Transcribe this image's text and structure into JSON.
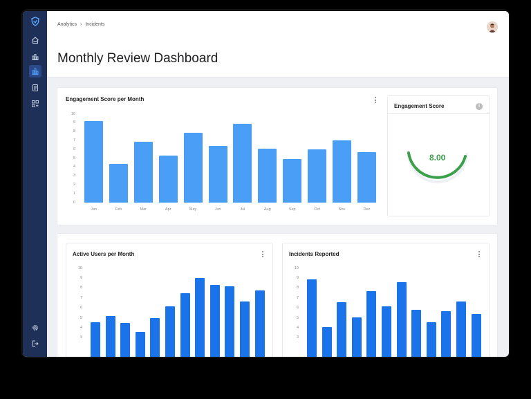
{
  "breadcrumb": {
    "items": [
      "Analytics",
      "Incidents"
    ],
    "separator": "›"
  },
  "page": {
    "title": "Monthly Review Dashboard"
  },
  "sidebar": {
    "icons": [
      "shield-logo-icon",
      "home-icon",
      "bar-chart-icon",
      "analytics-icon",
      "report-icon",
      "widgets-icon"
    ],
    "bottom_icons": [
      "settings-icon",
      "logout-icon"
    ],
    "active": "analytics-icon"
  },
  "engagement_chart": {
    "title": "Engagement Score per Month"
  },
  "gauge": {
    "title": "Engagement Score",
    "value": "8.00",
    "info": "i"
  },
  "users_chart": {
    "title": "Active Users per Month"
  },
  "incidents_chart": {
    "title": "Incidents Reported"
  },
  "colors": {
    "sidebar": "#1f3058",
    "bar_light": "#4a9ef5",
    "bar_dark": "#1a73e8",
    "gauge": "#3aa04a"
  },
  "chart_data": [
    {
      "type": "bar",
      "title": "Engagement Score per Month",
      "categories": [
        "Jan",
        "Feb",
        "Mar",
        "Apr",
        "May",
        "Jun",
        "Jul",
        "Aug",
        "Sep",
        "Oct",
        "Nov",
        "Dec"
      ],
      "values": [
        9.2,
        4.4,
        6.9,
        5.3,
        7.9,
        6.4,
        8.9,
        6.1,
        4.9,
        6.0,
        7.0,
        5.7
      ],
      "yticks": [
        0,
        1,
        2,
        3,
        4,
        5,
        6,
        7,
        8,
        9,
        10
      ],
      "ylim": [
        0,
        10
      ]
    },
    {
      "type": "bar",
      "title": "Active Users per Month",
      "values": [
        4.6,
        5.2,
        4.5,
        3.6,
        5.0,
        6.2,
        7.5,
        9.0,
        8.3,
        8.2,
        6.7,
        7.8
      ],
      "yticks": [
        3,
        4,
        5,
        6,
        7,
        8,
        9,
        10
      ],
      "ylim": [
        0,
        10
      ]
    },
    {
      "type": "bar",
      "title": "Incidents Reported",
      "values": [
        8.9,
        4.1,
        6.6,
        5.1,
        7.7,
        6.2,
        8.6,
        5.8,
        4.6,
        5.7,
        6.7,
        5.4
      ],
      "yticks": [
        3,
        4,
        5,
        6,
        7,
        8,
        9,
        10
      ],
      "ylim": [
        0,
        10
      ]
    }
  ]
}
